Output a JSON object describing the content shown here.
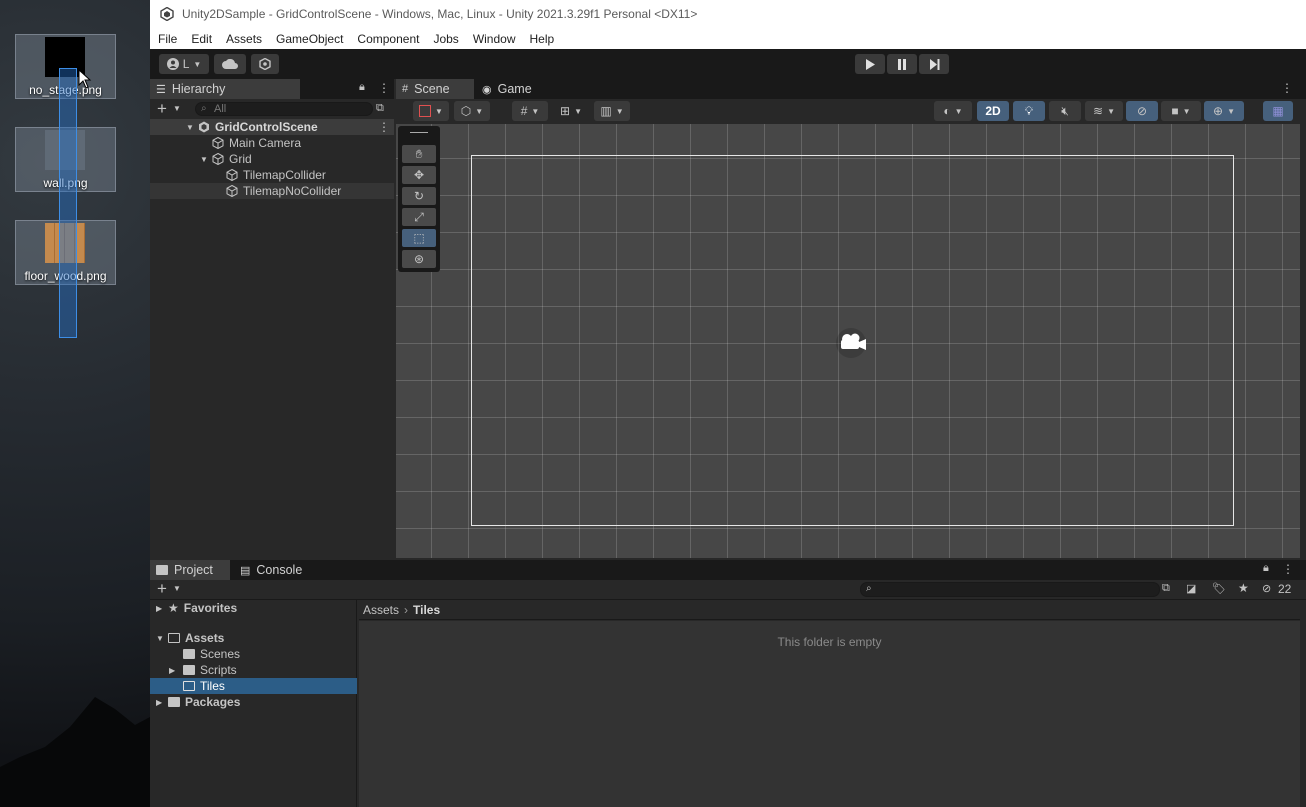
{
  "desktop": {
    "icons": [
      {
        "label": "no_stage.png",
        "thumb_color": "#000000"
      },
      {
        "label": "wall.png",
        "thumb_color": "#6f7a86"
      },
      {
        "label": "floor_wood.png",
        "thumb_color": "#c48a4e"
      }
    ]
  },
  "window": {
    "title": "Unity2DSample - GridControlScene - Windows, Mac, Linux - Unity 2021.3.29f1 Personal <DX11>"
  },
  "menu": [
    "File",
    "Edit",
    "Assets",
    "GameObject",
    "Component",
    "Jobs",
    "Window",
    "Help"
  ],
  "toolbar": {
    "account_label": "L",
    "play_icon": "play-icon",
    "pause_icon": "pause-icon",
    "step_icon": "step-icon"
  },
  "hierarchy": {
    "tab_label": "Hierarchy",
    "search_placeholder": "All",
    "items": [
      {
        "label": "GridControlScene",
        "depth": 0
      },
      {
        "label": "Main Camera",
        "depth": 1
      },
      {
        "label": "Grid",
        "depth": 1
      },
      {
        "label": "TilemapCollider",
        "depth": 2
      },
      {
        "label": "TilemapNoCollider",
        "depth": 2
      }
    ]
  },
  "scene": {
    "tabs": [
      {
        "label": "Scene"
      },
      {
        "label": "Game"
      }
    ],
    "mode_2d_label": "2D"
  },
  "project": {
    "tabs": [
      {
        "label": "Project"
      },
      {
        "label": "Console"
      }
    ],
    "hidden_count": "22",
    "tree": [
      {
        "label": "Favorites"
      },
      {
        "label": "Assets"
      },
      {
        "label": "Scenes"
      },
      {
        "label": "Scripts"
      },
      {
        "label": "Tiles"
      },
      {
        "label": "Packages"
      }
    ],
    "breadcrumb": [
      "Assets",
      "Tiles"
    ],
    "empty_message": "This folder is empty"
  },
  "colors": {
    "selection": "#2c5d87",
    "active_tool": "#46607c",
    "panel": "#282828",
    "toolbar": "#191919"
  }
}
